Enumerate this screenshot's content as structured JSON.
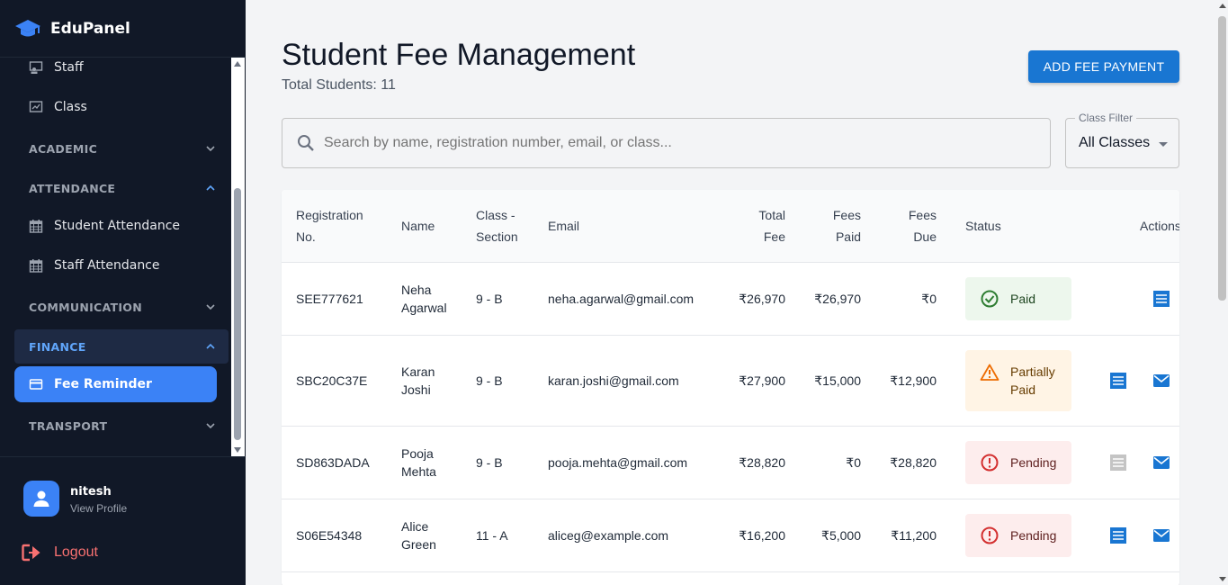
{
  "brand": {
    "name": "EduPanel"
  },
  "sidebar": {
    "items": [
      {
        "label": "Staff",
        "icon": "staff-icon"
      },
      {
        "label": "Class",
        "icon": "class-icon"
      }
    ],
    "sections": {
      "academic": "ACADEMIC",
      "attendance": "ATTENDANCE",
      "communication": "COMMUNICATION",
      "finance": "FINANCE",
      "transport": "TRANSPORT"
    },
    "attendance_items": [
      {
        "label": "Student Attendance",
        "icon": "calendar-icon"
      },
      {
        "label": "Staff Attendance",
        "icon": "calendar-icon"
      }
    ],
    "finance_items": [
      {
        "label": "Fee Reminder",
        "icon": "credit-card-icon"
      }
    ]
  },
  "profile": {
    "name": "nitesh",
    "link": "View Profile",
    "logout": "Logout"
  },
  "page": {
    "title": "Student Fee Management",
    "subtitle": "Total Students: 11",
    "add_button": "ADD FEE PAYMENT"
  },
  "search": {
    "placeholder": "Search by name, registration number, email, or class..."
  },
  "filter": {
    "label": "Class Filter",
    "value": "All Classes"
  },
  "table": {
    "headers": {
      "reg1": "Registration",
      "reg2": "No.",
      "name": "Name",
      "class1": "Class -",
      "class2": "Section",
      "email": "Email",
      "total1": "Total",
      "total2": "Fee",
      "paid1": "Fees",
      "paid2": "Paid",
      "due1": "Fees",
      "due2": "Due",
      "status": "Status",
      "actions": "Actions"
    },
    "rows": [
      {
        "reg": "SEE777621",
        "name1": "Neha",
        "name2": "Agarwal",
        "class": "9 - B",
        "email": "neha.agarwal@gmail.com",
        "total": "₹26,970",
        "paid": "₹26,970",
        "due": "₹0",
        "status": "Paid",
        "status2": ""
      },
      {
        "reg": "SBC20C37E",
        "name1": "Karan",
        "name2": "Joshi",
        "class": "9 - B",
        "email": "karan.joshi@gmail.com",
        "total": "₹27,900",
        "paid": "₹15,000",
        "due": "₹12,900",
        "status": "Partially",
        "status2": "Paid"
      },
      {
        "reg": "SD863DADA",
        "name1": "Pooja",
        "name2": "Mehta",
        "class": "9 - B",
        "email": "pooja.mehta@gmail.com",
        "total": "₹28,820",
        "paid": "₹0",
        "due": "₹28,820",
        "status": "Pending",
        "status2": ""
      },
      {
        "reg": "S06E54348",
        "name1": "Alice",
        "name2": "Green",
        "class": "11 - A",
        "email": "aliceg@example.com",
        "total": "₹16,200",
        "paid": "₹5,000",
        "due": "₹11,200",
        "status": "Pending",
        "status2": ""
      }
    ]
  },
  "colors": {
    "sidebar_bg": "#111827",
    "accent": "#3b82f6",
    "primary_button": "#1976d2",
    "paid": "#2e7d32",
    "partial": "#ed6c02",
    "pending": "#d32f2f"
  }
}
